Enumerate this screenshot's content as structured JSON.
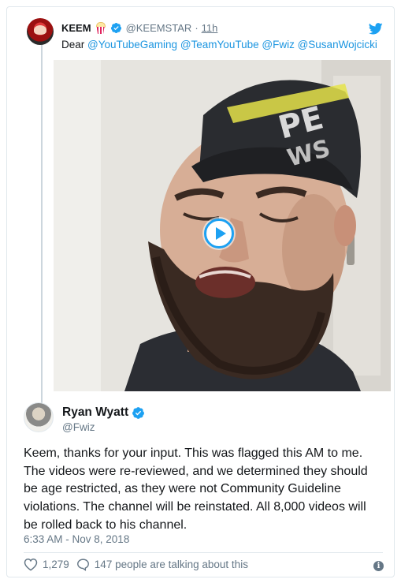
{
  "quoted_tweet": {
    "name": "KEEM",
    "handle": "@KEEMSTAR",
    "separator": "·",
    "time": "11h",
    "text_prefix": "Dear",
    "mentions": [
      "@YouTubeGaming",
      "@TeamYouTube",
      "@Fwiz",
      "@SusanWojcicki"
    ],
    "icons": [
      "popcorn-emoji-icon",
      "verified-badge-icon",
      "twitter-bird-icon",
      "play-icon"
    ]
  },
  "reply_tweet": {
    "name": "Ryan Wyatt",
    "handle": "@Fwiz",
    "text_lines": [
      "Keem, thanks for your input. This was flagged this AM to me.",
      "The videos were re-reviewed, and we determined they should",
      "be age restricted, as they were not Community Guideline",
      "violations. The channel will be reinstated. All 8,000 videos will",
      "be rolled back to his channel."
    ],
    "timestamp": "6:33 AM - Nov 8, 2018",
    "likes": "1,279",
    "talking": "147 people are talking about this",
    "icons": [
      "verified-badge-icon",
      "heart-icon",
      "comment-icon",
      "info-icon"
    ]
  },
  "colors": {
    "link": "#1b95e0",
    "verified": "#1da1f2",
    "secondary_text": "#657786",
    "border": "#e1e8ed"
  }
}
